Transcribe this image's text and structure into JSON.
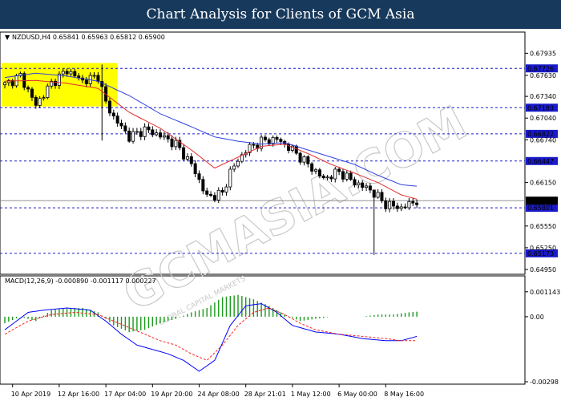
{
  "header": {
    "title": "Chart Analysis for Clients of GCM Asia"
  },
  "watermark": {
    "text": "GCMASIA.COM",
    "sub": "GLOBAL CAPITAL MARKETS"
  },
  "chart_data": [
    {
      "type": "candlestick",
      "symbol_label": "NZDUSD,H4  0.65841 0.65963 0.65812 0.65900",
      "ylim": [
        0.6495,
        0.6805
      ],
      "yticks": [
        "0.67935",
        "0.67630",
        "0.67340",
        "0.67040",
        "0.66740",
        "0.66150",
        "0.65550",
        "0.65250",
        "0.64950"
      ],
      "levels": [
        {
          "value": 0.67726,
          "label": "0.67726",
          "kind": "resistance"
        },
        {
          "value": 0.67183,
          "label": "0.67183",
          "kind": "resistance"
        },
        {
          "value": 0.66822,
          "label": "0.66822",
          "kind": "resistance"
        },
        {
          "value": 0.66447,
          "label": "0.66447",
          "kind": "resistance"
        },
        {
          "value": 0.65801,
          "label": "0.65801",
          "kind": "support"
        },
        {
          "value": 0.65173,
          "label": "0.65173",
          "kind": "support"
        }
      ],
      "current_price": {
        "value": 0.659,
        "label": "0.65900"
      },
      "highlight_zone": {
        "x_from": 0,
        "x_to": 29,
        "y_from": 0.672,
        "y_to": 0.678,
        "color": "#ffff00"
      },
      "x_ticks": [
        {
          "i": 2,
          "label": "10 Apr 2019"
        },
        {
          "i": 14,
          "label": "12 Apr 16:00"
        },
        {
          "i": 26,
          "label": "17 Apr 04:00"
        },
        {
          "i": 38,
          "label": "19 Apr 20:00"
        },
        {
          "i": 50,
          "label": "24 Apr 08:00"
        },
        {
          "i": 62,
          "label": "28 Apr 21:01"
        },
        {
          "i": 74,
          "label": "1 May 12:00"
        },
        {
          "i": 86,
          "label": "6 May 00:00"
        },
        {
          "i": 98,
          "label": "8 May 16:00"
        }
      ],
      "close_path": [
        [
          0,
          0.675
        ],
        [
          4,
          0.6762
        ],
        [
          8,
          0.6722
        ],
        [
          12,
          0.6752
        ],
        [
          16,
          0.677
        ],
        [
          20,
          0.6755
        ],
        [
          24,
          0.6762
        ],
        [
          26,
          0.6725
        ],
        [
          28,
          0.6705
        ],
        [
          32,
          0.6678
        ],
        [
          36,
          0.6688
        ],
        [
          40,
          0.668
        ],
        [
          44,
          0.6668
        ],
        [
          48,
          0.664
        ],
        [
          50,
          0.6618
        ],
        [
          52,
          0.6595
        ],
        [
          56,
          0.66
        ],
        [
          58,
          0.663
        ],
        [
          62,
          0.666
        ],
        [
          66,
          0.6672
        ],
        [
          70,
          0.6675
        ],
        [
          74,
          0.666
        ],
        [
          78,
          0.664
        ],
        [
          82,
          0.662
        ],
        [
          86,
          0.663
        ],
        [
          90,
          0.6615
        ],
        [
          94,
          0.6605
        ],
        [
          98,
          0.6585
        ],
        [
          102,
          0.658
        ],
        [
          106,
          0.659
        ]
      ],
      "wicks": [
        {
          "i": 25,
          "low": 0.6673,
          "high": 0.6778
        },
        {
          "i": 95,
          "low": 0.6515,
          "high": 0.6598
        }
      ],
      "ma_fast": {
        "color": "#e03030",
        "points": [
          [
            0,
            0.6755
          ],
          [
            8,
            0.6756
          ],
          [
            16,
            0.6752
          ],
          [
            24,
            0.6745
          ],
          [
            32,
            0.6712
          ],
          [
            40,
            0.669
          ],
          [
            48,
            0.666
          ],
          [
            54,
            0.6635
          ],
          [
            60,
            0.665
          ],
          [
            66,
            0.6665
          ],
          [
            72,
            0.6668
          ],
          [
            78,
            0.6655
          ],
          [
            84,
            0.664
          ],
          [
            90,
            0.6628
          ],
          [
            96,
            0.6615
          ],
          [
            102,
            0.6598
          ],
          [
            106,
            0.6592
          ]
        ]
      },
      "ma_slow": {
        "color": "#3040e0",
        "points": [
          [
            0,
            0.676
          ],
          [
            8,
            0.6766
          ],
          [
            16,
            0.6762
          ],
          [
            24,
            0.6755
          ],
          [
            32,
            0.6735
          ],
          [
            40,
            0.671
          ],
          [
            48,
            0.6692
          ],
          [
            54,
            0.6678
          ],
          [
            60,
            0.6672
          ],
          [
            66,
            0.6668
          ],
          [
            72,
            0.667
          ],
          [
            78,
            0.666
          ],
          [
            84,
            0.665
          ],
          [
            90,
            0.664
          ],
          [
            96,
            0.6625
          ],
          [
            102,
            0.6612
          ],
          [
            106,
            0.661
          ]
        ]
      }
    },
    {
      "type": "macd",
      "label": "MACD(12,26,9) -0.000890 -0.001117 0.000227",
      "ylim": [
        -0.00298,
        0.00143
      ],
      "yticks": [
        "0.001143",
        "0.00",
        "-0.00298"
      ],
      "histogram_color": "#1a9a1a",
      "histogram": [
        [
          0,
          -0.0003
        ],
        [
          4,
          0.0
        ],
        [
          8,
          -0.0002
        ],
        [
          12,
          0.0003
        ],
        [
          16,
          0.0004
        ],
        [
          20,
          0.0004
        ],
        [
          24,
          0.0002
        ],
        [
          28,
          -0.0004
        ],
        [
          32,
          -0.0007
        ],
        [
          36,
          -0.0006
        ],
        [
          40,
          -0.0003
        ],
        [
          44,
          -0.0001
        ],
        [
          48,
          0.0002
        ],
        [
          52,
          0.0004
        ],
        [
          56,
          0.0009
        ],
        [
          60,
          0.001
        ],
        [
          64,
          0.0008
        ],
        [
          68,
          0.0005
        ],
        [
          72,
          0.0001
        ],
        [
          76,
          -0.0002
        ],
        [
          80,
          -0.0001
        ],
        [
          84,
          0.0
        ],
        [
          88,
          0.0
        ],
        [
          92,
          0.0
        ],
        [
          96,
          0.0001
        ],
        [
          100,
          0.0001
        ],
        [
          104,
          0.0002
        ],
        [
          106,
          0.00023
        ]
      ],
      "macd_line": {
        "color": "#0000ff",
        "points": [
          [
            0,
            -0.0006
          ],
          [
            6,
            0.0002
          ],
          [
            10,
            0.0003
          ],
          [
            16,
            0.0004
          ],
          [
            22,
            0.0003
          ],
          [
            26,
            -0.0002
          ],
          [
            30,
            -0.0008
          ],
          [
            34,
            -0.0013
          ],
          [
            38,
            -0.0015
          ],
          [
            42,
            -0.0017
          ],
          [
            46,
            -0.002
          ],
          [
            50,
            -0.0025
          ],
          [
            54,
            -0.002
          ],
          [
            58,
            -0.0004
          ],
          [
            62,
            0.0005
          ],
          [
            66,
            0.0006
          ],
          [
            70,
            0.0002
          ],
          [
            74,
            -0.0004
          ],
          [
            80,
            -0.0007
          ],
          [
            86,
            -0.0008
          ],
          [
            92,
            -0.001
          ],
          [
            98,
            -0.0011
          ],
          [
            102,
            -0.0011
          ],
          [
            106,
            -0.0009
          ]
        ]
      },
      "signal_line": {
        "color": "#ff2020",
        "points": [
          [
            0,
            -0.0008
          ],
          [
            6,
            -0.0002
          ],
          [
            12,
            0.0001
          ],
          [
            18,
            0.0002
          ],
          [
            24,
            0.0001
          ],
          [
            28,
            -0.0002
          ],
          [
            32,
            -0.0005
          ],
          [
            36,
            -0.0008
          ],
          [
            40,
            -0.0011
          ],
          [
            44,
            -0.0013
          ],
          [
            48,
            -0.0017
          ],
          [
            52,
            -0.002
          ],
          [
            56,
            -0.0013
          ],
          [
            60,
            -0.0004
          ],
          [
            64,
            0.0002
          ],
          [
            68,
            0.0004
          ],
          [
            72,
            0.0001
          ],
          [
            76,
            -0.0003
          ],
          [
            80,
            -0.0006
          ],
          [
            86,
            -0.0008
          ],
          [
            92,
            -0.0009
          ],
          [
            98,
            -0.001
          ],
          [
            102,
            -0.0011
          ],
          [
            106,
            -0.0011
          ]
        ]
      }
    }
  ]
}
